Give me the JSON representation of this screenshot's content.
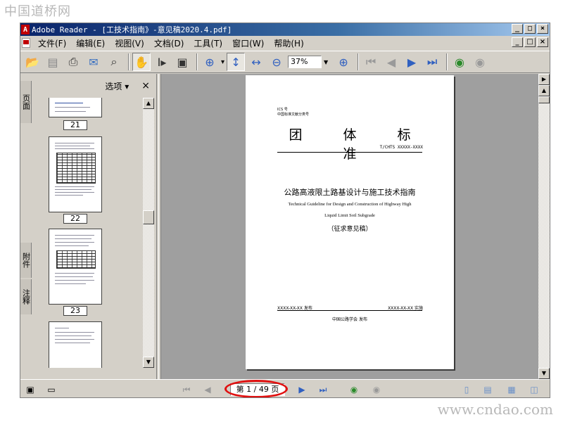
{
  "watermarks": {
    "top": "中国道桥网",
    "bottom": "www.cndao.com"
  },
  "window": {
    "title": "Adobe Reader - [工技术指南》-意见稿2020.4.pdf]",
    "app_icon": "A",
    "controls": {
      "minimize": "_",
      "maximize": "□",
      "close": "×"
    }
  },
  "menubar": {
    "items": [
      "文件(F)",
      "编辑(E)",
      "视图(V)",
      "文档(D)",
      "工具(T)",
      "窗口(W)",
      "帮助(H)"
    ]
  },
  "toolbar": {
    "zoom_value": "37%",
    "icons": [
      "open-icon",
      "save-icon",
      "print-icon",
      "email-icon",
      "search-icon",
      "hand-tool-icon",
      "select-text-icon",
      "snapshot-icon",
      "zoom-in-icon",
      "fit-page-icon",
      "fit-width-icon",
      "zoom-out-icon",
      "zoom-in-plus-icon",
      "first-page-icon",
      "prev-page-icon",
      "next-page-icon",
      "last-page-icon",
      "back-icon",
      "forward-icon"
    ]
  },
  "leftpanel": {
    "tabs": [
      "页面",
      "附件",
      "注释"
    ],
    "options_label": "选项 ▾",
    "close_label": "×",
    "thumbnails": [
      {
        "page_label": "21"
      },
      {
        "page_label": "22"
      },
      {
        "page_label": "23"
      }
    ]
  },
  "document_page": {
    "ics": "ICS 号",
    "classification": "中国标准文献分类号",
    "type_title": "团 体 标 准",
    "code": "T/CHTS XXXXX-XXXX",
    "cn_title": "公路高液限土路基设计与施工技术指南",
    "en_title_line1": "Technical Guideline for Design and Construction of Highway High",
    "en_title_line2": "Liquid Limit Soil Subgrade",
    "draft_note": "（征求意见稿）",
    "publish_date": "XXXX-XX-XX 发布",
    "implement_date": "XXXX-XX-XX 实施",
    "publisher": "中国公路学会 发布"
  },
  "statusbar": {
    "page_indicator": "第 1 / 49 页",
    "highlight_color": "#e01010"
  }
}
